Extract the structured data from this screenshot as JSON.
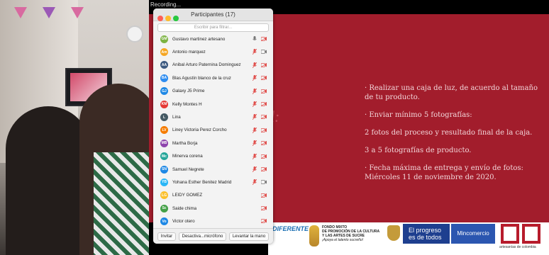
{
  "recording_label": "Recording...",
  "participants_window": {
    "title": "Participantes (17)",
    "search_placeholder": "Escribir para filtrar...",
    "participants": [
      {
        "initials": "GM",
        "name": "Gustavo martinez artesano",
        "color": "#7cb342",
        "mic": "on",
        "cam": "off"
      },
      {
        "initials": "Am",
        "name": "Antonio marquez",
        "color": "#f5a623",
        "mic": "muted",
        "cam": "on"
      },
      {
        "initials": "AA",
        "name": "Anibal Arturo Paternina Dominguez",
        "color": "#3d5a80",
        "mic": "muted",
        "cam": "off"
      },
      {
        "initials": "BA",
        "name": "Blas Agustín blanco de la cruz",
        "color": "#2d8cf0",
        "mic": "muted",
        "cam": "off"
      },
      {
        "initials": "GJ",
        "name": "Galaxy J5 Prime",
        "color": "#1e88e5",
        "mic": "muted",
        "cam": "off"
      },
      {
        "initials": "KM",
        "name": "Kelly Montes H",
        "color": "#e53935",
        "mic": "muted",
        "cam": "off"
      },
      {
        "initials": "L",
        "name": "Lina",
        "color": "#455a64",
        "mic": "muted",
        "cam": "off"
      },
      {
        "initials": "LV",
        "name": "Liney Victoria Perez Corcho",
        "color": "#f57c00",
        "mic": "muted",
        "cam": "off"
      },
      {
        "initials": "MB",
        "name": "Martha Borja",
        "color": "#8e44ad",
        "mic": "muted",
        "cam": "off"
      },
      {
        "initials": "Mc",
        "name": "Minerva corena",
        "color": "#26a69a",
        "mic": "muted",
        "cam": "off"
      },
      {
        "initials": "SN",
        "name": "Samuel Negrete",
        "color": "#1e88e5",
        "mic": "muted",
        "cam": "off"
      },
      {
        "initials": "YB",
        "name": "Yohana Esther Benitez Madrid",
        "color": "#29b6f6",
        "mic": "muted",
        "cam": "on"
      },
      {
        "initials": "LG",
        "name": "LEIDY GÓMEZ",
        "color": "#fbc02d",
        "mic": "none",
        "cam": "off"
      },
      {
        "initials": "Sc",
        "name": "Saide chima",
        "color": "#43a047",
        "mic": "none",
        "cam": "off"
      },
      {
        "initials": "Vo",
        "name": "Victor otero",
        "color": "#1e88e5",
        "mic": "none",
        "cam": "off"
      }
    ],
    "buttons": {
      "invite": "Invitar",
      "mute_all": "Desactiva...micrófono",
      "raise_hand": "Levantar la mano"
    }
  },
  "slide": {
    "ghost_text": "d:",
    "bullets": [
      "· Realizar una caja de luz, de acuerdo al tamaño de tu producto.",
      "· Enviar mínimo 5 fotografías:",
      "2 fotos del proceso y  resultado final de la caja.",
      "3 a 5 fotografías de producto.",
      "· Fecha máxima de entrega y envío de fotos: Miércoles 11 de noviembre de 2020."
    ]
  },
  "sponsors": {
    "diferente": "DIFERENTE",
    "fondo_lines": [
      "FONDO MIXTO",
      "DE PROMOCIÓN DE LA CULTURA",
      "Y LAS ARTES DE SUCRE",
      "¡Apoya el talento sucreño!"
    ],
    "progreso": "El progreso es de todos",
    "mincomercio": "Mincomercio",
    "artesanias": "artesanías de colombia"
  },
  "colors": {
    "slide_red": "#a21d2c",
    "panel_bg": "#f3f3f3",
    "muted_red": "#e0504d"
  }
}
